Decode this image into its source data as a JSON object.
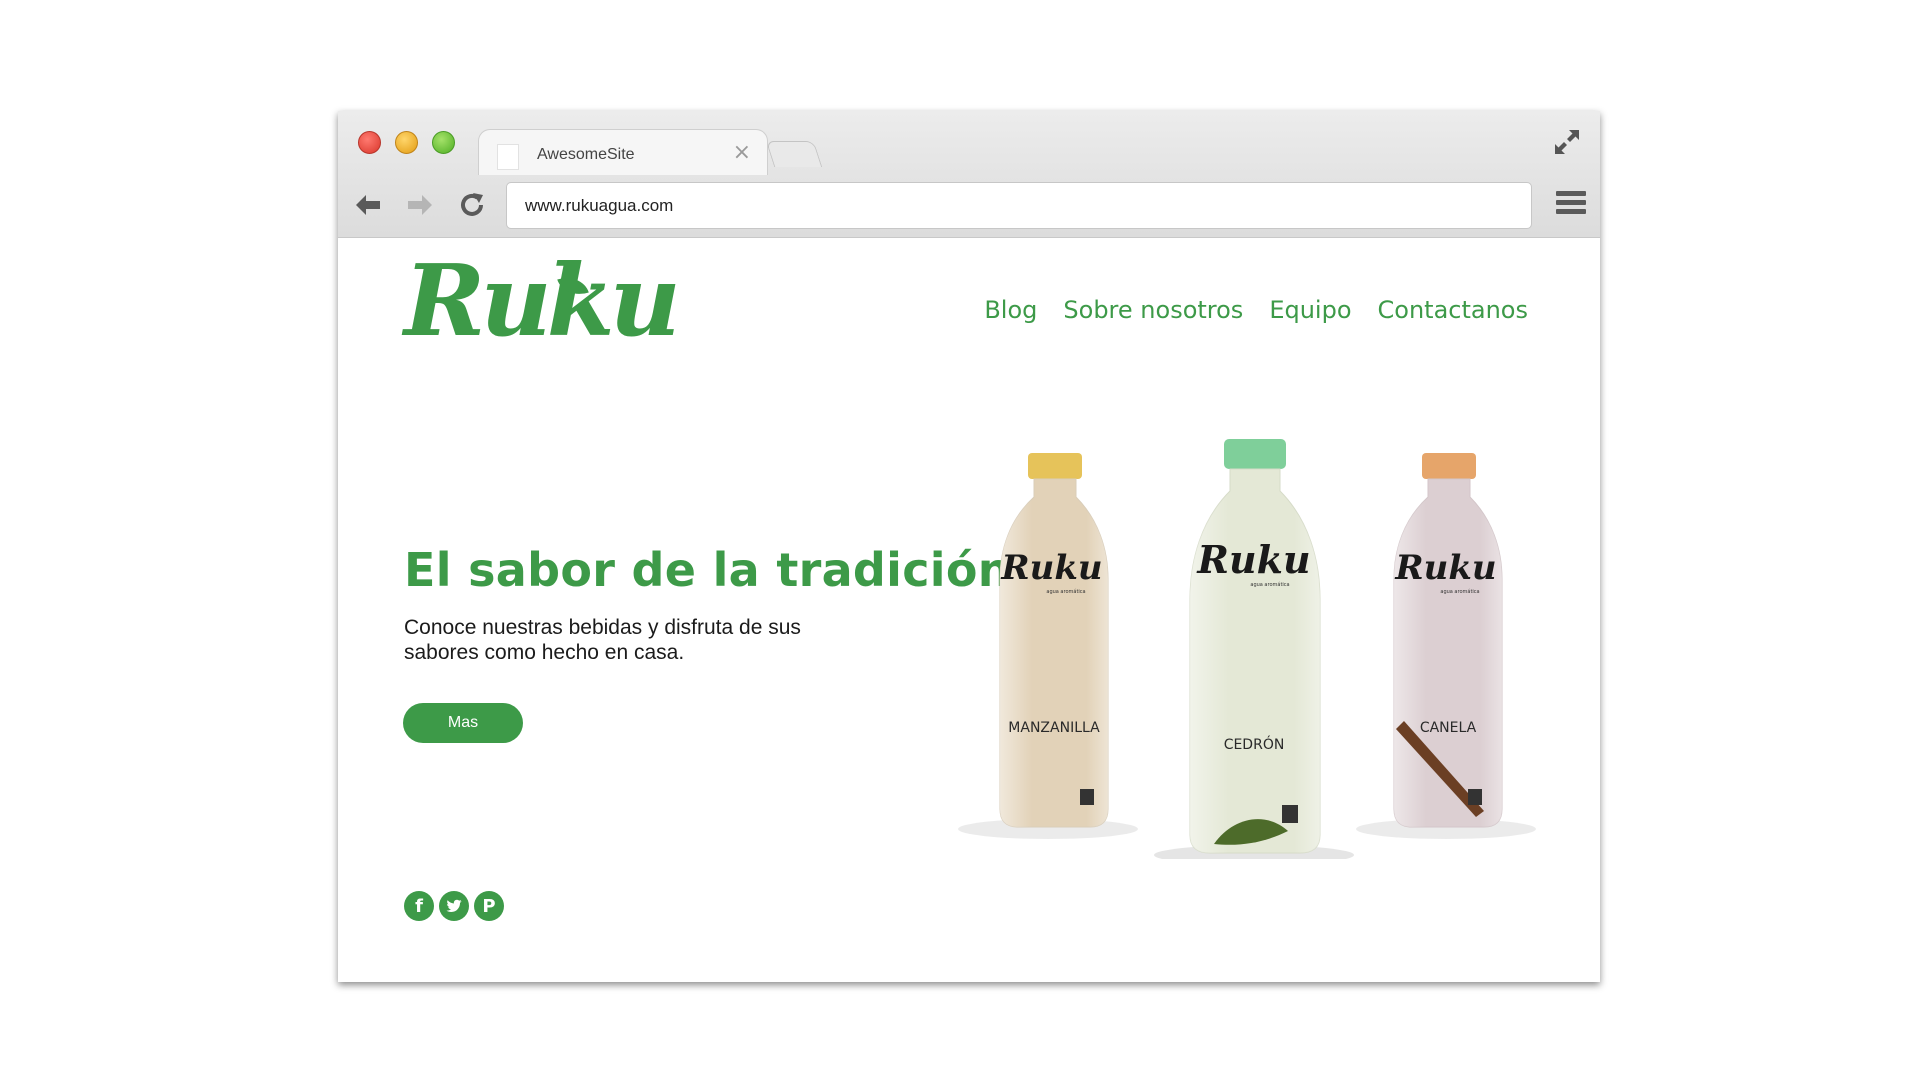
{
  "browser": {
    "tab_title": "AwesomeSite",
    "tab_close": "×",
    "url": "www.rukuagua.com"
  },
  "site": {
    "logo_text": "Ruku",
    "nav": [
      {
        "label": "Blog"
      },
      {
        "label": "Sobre nosotros"
      },
      {
        "label": "Equipo"
      },
      {
        "label": "Contactanos"
      }
    ],
    "hero": {
      "title": "El sabor de la tradición",
      "subtitle": "Conoce nuestras bebidas y disfruta de sus sabores como hecho en casa.",
      "cta_label": "Mas"
    },
    "products": [
      {
        "brand": "Ruku",
        "tagline": "agua aromática",
        "name": "MANZANILLA",
        "cap_color": "#e6c35a",
        "liquid_color": "#e2d2b8"
      },
      {
        "brand": "Ruku",
        "tagline": "agua aromática",
        "name": "CEDRÓN",
        "cap_color": "#7fcf9a",
        "liquid_color": "#e4e8d6"
      },
      {
        "brand": "Ruku",
        "tagline": "agua aromática",
        "name": "CANELA",
        "cap_color": "#e6a56a",
        "liquid_color": "#dccfd2"
      }
    ],
    "socials": [
      {
        "icon": "facebook-icon",
        "glyph": "f"
      },
      {
        "icon": "twitter-icon"
      },
      {
        "icon": "pinterest-icon",
        "glyph": "P"
      }
    ],
    "accent_color": "#3d9a48"
  }
}
